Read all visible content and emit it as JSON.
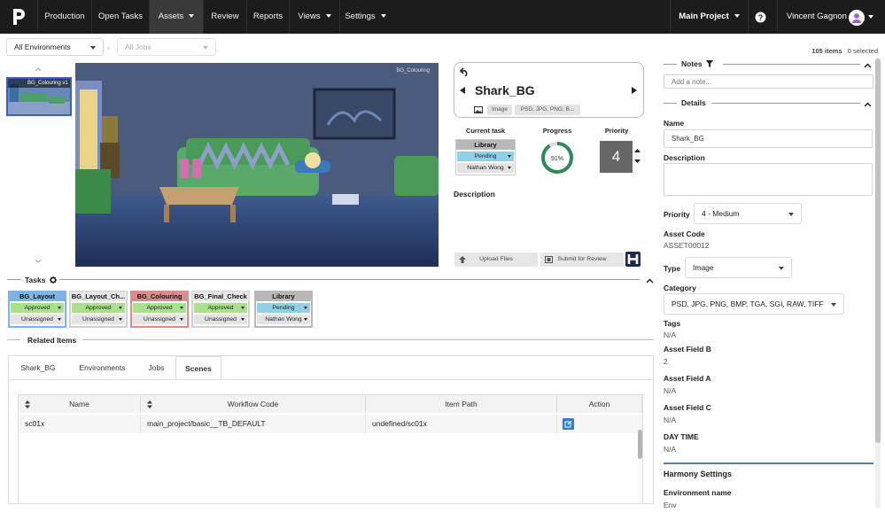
{
  "nav": {
    "items": [
      {
        "label": "Production",
        "caret": false,
        "active": false
      },
      {
        "label": "Open Tasks",
        "caret": false,
        "active": false
      },
      {
        "label": "Assets",
        "caret": true,
        "active": true
      },
      {
        "label": "Review",
        "caret": false,
        "active": false
      },
      {
        "label": "Reports",
        "caret": false,
        "active": false
      },
      {
        "label": "Views",
        "caret": true,
        "active": false
      },
      {
        "label": "Settings",
        "caret": true,
        "active": false
      }
    ],
    "project": "Main Project",
    "help_icon": "question-circle-icon",
    "user": "Vincent Gagnon"
  },
  "filters": {
    "environment": "All Environments",
    "jobs_placeholder": "All Jobs",
    "items_count": "105 items",
    "selected_count": "0 selected"
  },
  "thumbnail": {
    "label": "BG_Colouring v1"
  },
  "viewer": {
    "overlay_label": "BG_Colouring"
  },
  "card": {
    "title": "Shark_BG",
    "type_pill": "Image",
    "format_pill": "PSD, JPG, PNG, B..."
  },
  "current_task": {
    "label": "Current task",
    "name": "Library",
    "status": "Pending",
    "assignee": "Nathan Wong"
  },
  "progress": {
    "label": "Progress",
    "value": 91,
    "text": "91%"
  },
  "priority": {
    "label": "Priority",
    "value": "4"
  },
  "description_label": "Description",
  "actions": {
    "upload": "Upload Files",
    "submit": "Submit for Review"
  },
  "tasks": {
    "title": "Tasks",
    "items": [
      {
        "name": "BG_Layout",
        "status": "Approved",
        "assignee": "Unassigned",
        "color": "#7fb3e6",
        "border": "#7fb3e6"
      },
      {
        "name": "BG_Layout_Ch...",
        "status": "Approved",
        "assignee": "Unassigned",
        "color": "#e6e6e6",
        "border": "#d0d0d0"
      },
      {
        "name": "BG_Colouring",
        "status": "Approved",
        "assignee": "Unassigned",
        "color": "#d98c8c",
        "border": "#d98c8c"
      },
      {
        "name": "BG_Final_Check",
        "status": "Approved",
        "assignee": "Unassigned",
        "color": "#e6e6e6",
        "border": "#d0d0d0"
      },
      {
        "name": "Library",
        "status": "Pending",
        "assignee": "Nathan Wong",
        "color": "#b8b8b8",
        "border": "#b8b8b8"
      }
    ]
  },
  "related": {
    "title": "Related Items",
    "tabs": [
      "Shark_BG",
      "Environments",
      "Jobs",
      "Scenes"
    ],
    "active_tab": 3,
    "columns": [
      "Name",
      "Workflow Code",
      "Item Path",
      "Action"
    ],
    "rows": [
      {
        "name": "sc01x",
        "workflow": "main_project/basic__TB_DEFAULT",
        "path": "undefined/sc01x"
      }
    ]
  },
  "right": {
    "notes_title": "Notes",
    "note_placeholder": "Add a note...",
    "details_title": "Details",
    "name_label": "Name",
    "name_value": "Shark_BG",
    "description_label": "Description",
    "priority_label": "Priority",
    "priority_value": "4 - Medium",
    "asset_code_label": "Asset Code",
    "asset_code_value": "ASSET00012",
    "type_label": "Type",
    "type_value": "Image",
    "category_label": "Category",
    "category_value": "PSD, JPG, PNG, BMP, TGA, SGI, RAW, TIFF",
    "tags_label": "Tags",
    "tags_value": "N/A",
    "field_b_label": "Asset Field B",
    "field_b_value": "2",
    "field_a_label": "Asset Field A",
    "field_a_value": "N/A",
    "field_c_label": "Asset Field C",
    "field_c_value": "N/A",
    "daytime_label": "DAY TIME",
    "daytime_value": "N/A",
    "harmony_title": "Harmony Settings",
    "env_name_label": "Environment name",
    "env_name_value": "Env"
  },
  "colors": {
    "nav_bg": "#1c1c1c",
    "pending": "#8fd0e8",
    "approved": "#a8e08c",
    "progress_ring": "#2e8b57",
    "action_blue": "#2a7fd0"
  }
}
